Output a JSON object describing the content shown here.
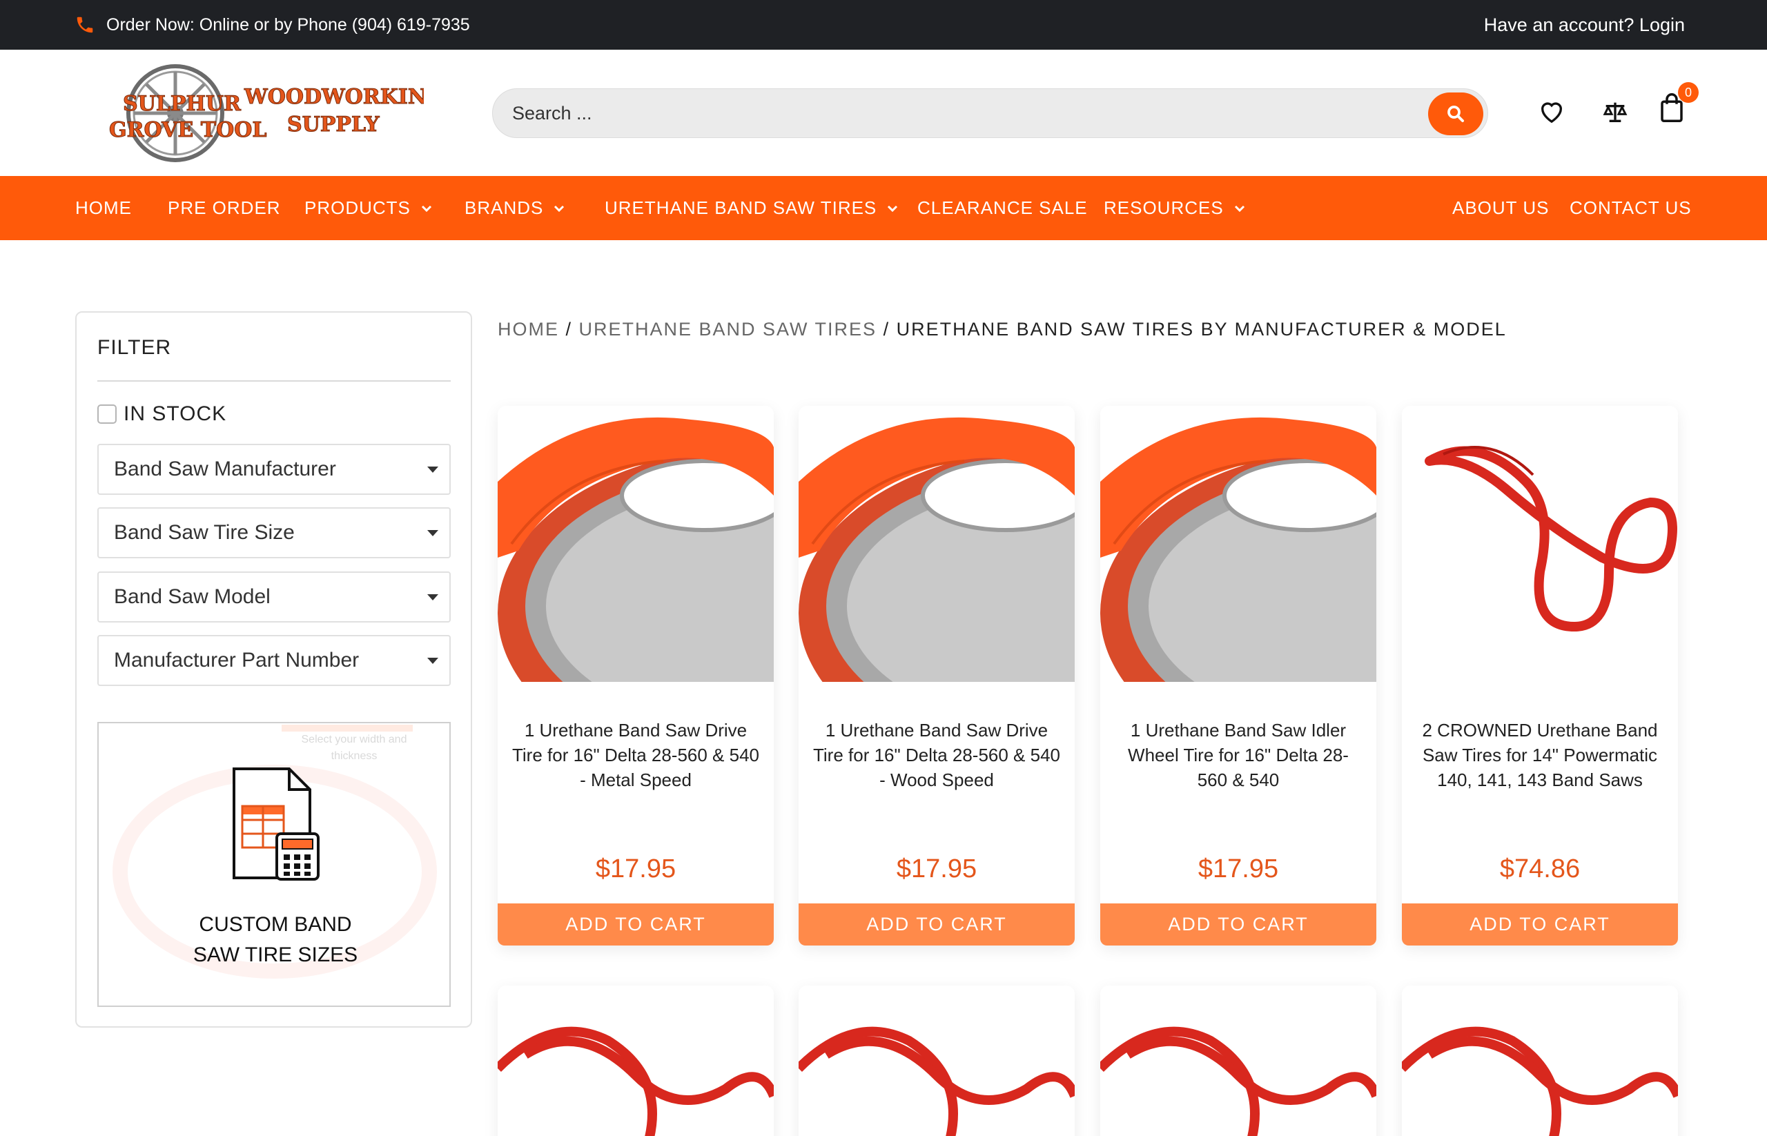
{
  "topbar": {
    "phone_text": "Order Now: Online or by Phone (904) 619-7935",
    "account_text": "Have an account? Login",
    "icons": {
      "phone": "phone-icon"
    }
  },
  "header": {
    "logo": {
      "line1": "SULPHUR",
      "line2": "GROVE TOOL",
      "line3": "WOODWORKING",
      "line4": "SUPPLY"
    },
    "search": {
      "placeholder": "Search ..."
    },
    "cart_count": "0",
    "icons": {
      "search": "search-icon",
      "wishlist": "heart-icon",
      "compare": "scale-icon",
      "cart": "shopping-bag-icon"
    }
  },
  "nav": {
    "items": [
      {
        "label": "HOME"
      },
      {
        "label": "PRE ORDER"
      },
      {
        "label": "PRODUCTS"
      },
      {
        "label": "BRANDS"
      },
      {
        "label": "URETHANE BAND SAW TIRES"
      },
      {
        "label": "CLEARANCE SALE"
      },
      {
        "label": "RESOURCES"
      },
      {
        "label": "ABOUT US"
      },
      {
        "label": "CONTACT US"
      }
    ]
  },
  "sidebar": {
    "title": "FILTER",
    "instock_label": "IN STOCK",
    "selects": [
      {
        "value": "Band Saw Manufacturer"
      },
      {
        "value": "Band Saw Tire Size"
      },
      {
        "value": "Band Saw Model"
      },
      {
        "value": "Manufacturer Part Number"
      }
    ],
    "custom": {
      "hint": "Select your width and thickness",
      "line1": "CUSTOM BAND",
      "line2": "SAW TIRE SIZES"
    }
  },
  "breadcrumb": {
    "home": "HOME",
    "sep": " / ",
    "level1": "URETHANE BAND SAW TIRES",
    "current": "URETHANE BAND SAW TIRES BY MANUFACTURER & MODEL"
  },
  "products": [
    {
      "title": "1 Urethane Band Saw Drive Tire for 16\" Delta 28-560 & 540 - Metal Speed",
      "price": "$17.95",
      "cta": "ADD TO CART"
    },
    {
      "title": "1 Urethane Band Saw Drive Tire for 16\" Delta 28-560 & 540 - Wood Speed",
      "price": "$17.95",
      "cta": "ADD TO CART"
    },
    {
      "title": "1 Urethane Band Saw Idler Wheel Tire for 16\" Delta 28-560 & 540",
      "price": "$17.95",
      "cta": "ADD TO CART"
    },
    {
      "title": "2 CROWNED Urethane Band Saw Tires for 14\" Powermatic 140, 141, 143 Band Saws",
      "price": "$74.86",
      "cta": "ADD TO CART"
    }
  ],
  "colors": {
    "accent": "#ff5a0a",
    "topbar": "#1f2125",
    "price": "#e4561b",
    "button": "#ff8a4a"
  }
}
